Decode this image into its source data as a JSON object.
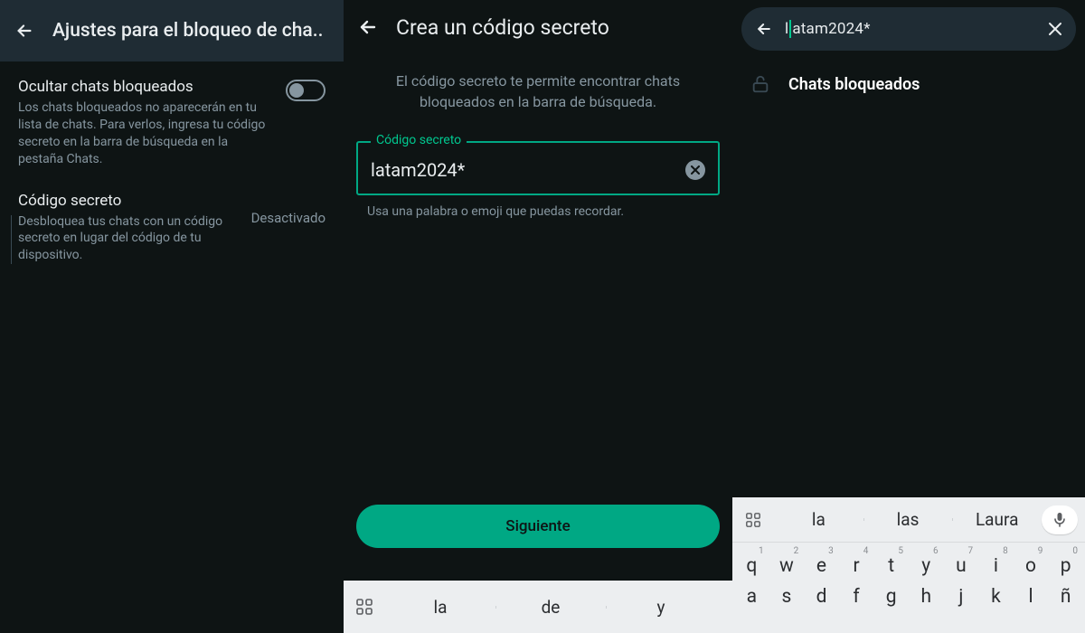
{
  "panel1": {
    "title": "Ajustes para el bloqueo de cha..",
    "hide": {
      "label": "Ocultar chats bloqueados",
      "desc": "Los chats bloqueados no aparecerán en tu lista de chats. Para verlos, ingresa tu código secreto en la barra de búsqueda en la pestaña Chats."
    },
    "code": {
      "label": "Código secreto",
      "desc": "Desbloquea tus chats con un código secreto en lugar del código de tu dispositivo.",
      "status": "Desactivado"
    }
  },
  "panel2": {
    "title": "Crea un código secreto",
    "intro": "El código secreto te permite encontrar chats bloqueados en la barra de búsqueda.",
    "field_legend": "Código secreto",
    "field_value": "latam2024*",
    "hint": "Usa una palabra o emoji que puedas recordar.",
    "next": "Siguiente",
    "suggestions": [
      "la",
      "de",
      "y"
    ]
  },
  "panel3": {
    "query_pre": "l",
    "query_post": "atam2024*",
    "result_title": "Chats bloqueados",
    "suggestions": [
      "la",
      "las",
      "Laura"
    ],
    "row1": [
      {
        "n": "1",
        "c": "q"
      },
      {
        "n": "2",
        "c": "w"
      },
      {
        "n": "3",
        "c": "e"
      },
      {
        "n": "4",
        "c": "r"
      },
      {
        "n": "5",
        "c": "t"
      },
      {
        "n": "6",
        "c": "y"
      },
      {
        "n": "7",
        "c": "u"
      },
      {
        "n": "8",
        "c": "i"
      },
      {
        "n": "9",
        "c": "o"
      },
      {
        "n": "0",
        "c": "p"
      }
    ],
    "row2": [
      "a",
      "s",
      "d",
      "f",
      "g",
      "h",
      "j",
      "k",
      "l",
      "ñ"
    ]
  }
}
